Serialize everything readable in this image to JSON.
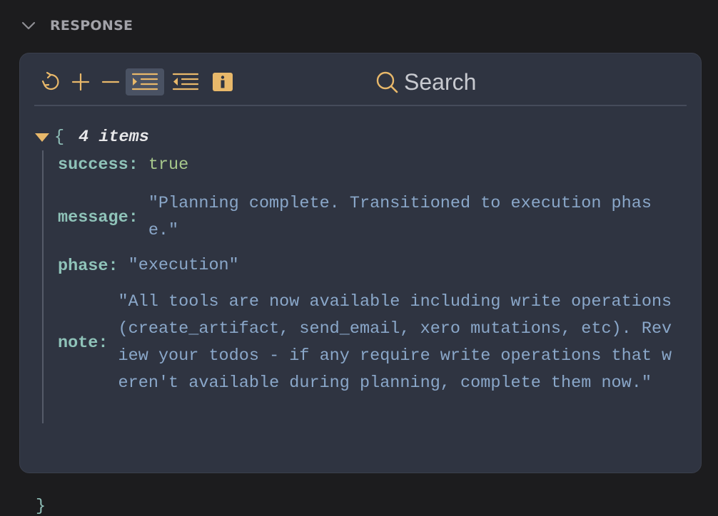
{
  "section": {
    "title": "RESPONSE",
    "toggle_icon": "chevron-down-icon"
  },
  "toolbar": {
    "buttons": [
      {
        "name": "collapse-all",
        "icon": "rotate-icon"
      },
      {
        "name": "expand",
        "icon": "plus-icon"
      },
      {
        "name": "collapse",
        "icon": "minus-icon"
      },
      {
        "name": "indent",
        "icon": "indent-icon",
        "active": true
      },
      {
        "name": "outdent",
        "icon": "outdent-icon"
      },
      {
        "name": "info",
        "icon": "info-icon"
      }
    ],
    "search_placeholder": "Search"
  },
  "tree": {
    "open_brace": "{",
    "close_brace": "}",
    "count": "4 items",
    "entries": [
      {
        "key": "success",
        "value": "true",
        "type": "boolean"
      },
      {
        "key": "message",
        "value": "\"Planning complete. Transitioned to execution phase.\"",
        "type": "string"
      },
      {
        "key": "phase",
        "value": "\"execution\"",
        "type": "string"
      },
      {
        "key": "note",
        "value": "\"All tools are now available including write operations (create_artifact, send_email, xero mutations, etc). Review your todos - if any require write operations that weren't available during planning, complete them now.\"",
        "type": "string"
      }
    ]
  },
  "colors": {
    "background": "#1c1c1e",
    "panel": "#2f3441",
    "accent_icon": "#e8b86a",
    "key": "#8fc3b9",
    "string": "#8aa7c9",
    "boolean": "#a7c88c"
  }
}
